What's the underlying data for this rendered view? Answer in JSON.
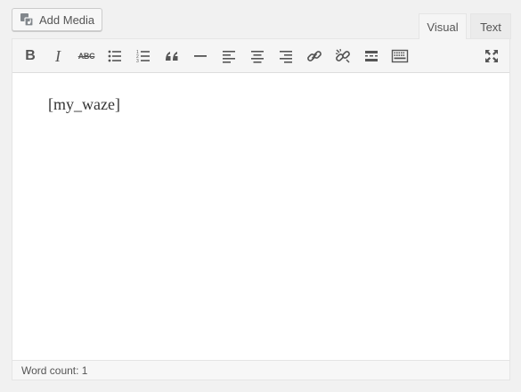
{
  "add_media": {
    "label": "Add Media",
    "icon": "media-icon"
  },
  "tabs": [
    {
      "label": "Visual",
      "active": true
    },
    {
      "label": "Text",
      "active": false
    }
  ],
  "toolbar": {
    "buttons": [
      {
        "name": "bold",
        "glyph": "B"
      },
      {
        "name": "italic",
        "glyph": "I"
      },
      {
        "name": "strikethrough",
        "glyph": "ABC"
      },
      {
        "name": "bulleted-list",
        "icon": "bulleted-list-icon"
      },
      {
        "name": "numbered-list",
        "icon": "numbered-list-icon"
      },
      {
        "name": "blockquote",
        "icon": "blockquote-icon"
      },
      {
        "name": "horizontal-line",
        "icon": "horizontal-line-icon"
      },
      {
        "name": "align-left",
        "icon": "align-left-icon"
      },
      {
        "name": "align-center",
        "icon": "align-center-icon"
      },
      {
        "name": "align-right",
        "icon": "align-right-icon"
      },
      {
        "name": "insert-link",
        "icon": "link-icon"
      },
      {
        "name": "remove-link",
        "icon": "unlink-icon"
      },
      {
        "name": "read-more",
        "icon": "read-more-icon"
      },
      {
        "name": "toolbar-toggle",
        "icon": "keyboard-icon"
      },
      {
        "name": "fullscreen",
        "icon": "fullscreen-icon"
      }
    ]
  },
  "editor": {
    "content": "[my_waze]"
  },
  "status": {
    "word_count": "Word count: 1"
  },
  "colors": {
    "background": "#f1f1f1",
    "toolbar": "#f5f5f5",
    "icon": "#555555",
    "border": "#e5e5e5",
    "content_text": "#333333"
  }
}
